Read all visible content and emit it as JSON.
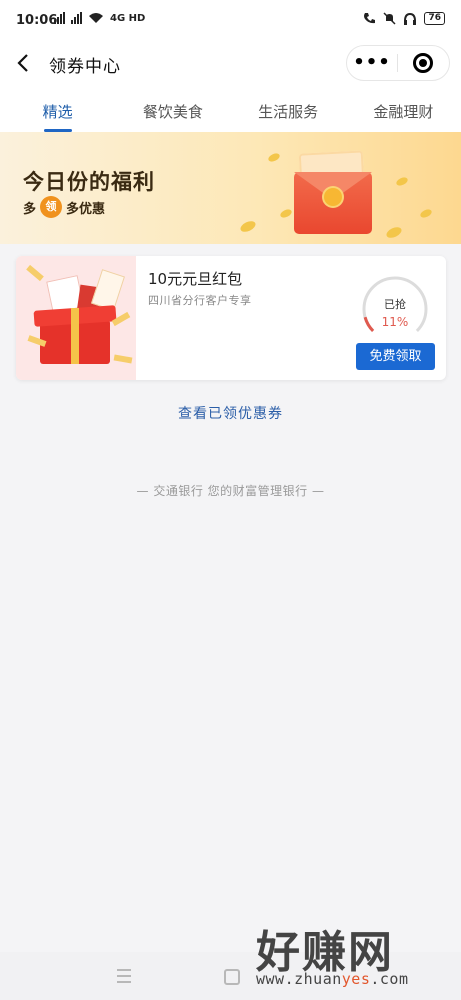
{
  "status_bar": {
    "time": "10:06",
    "network_label": "4G HD",
    "battery": "76"
  },
  "nav": {
    "title": "领券中心",
    "more_label": "•••"
  },
  "tabs": [
    {
      "label": "精选",
      "active": true
    },
    {
      "label": "餐饮美食",
      "active": false
    },
    {
      "label": "生活服务",
      "active": false
    },
    {
      "label": "金融理财",
      "active": false
    }
  ],
  "banner": {
    "title": "今日份的福利",
    "sub_prefix": "多",
    "sub_badge": "领",
    "sub_suffix": "多优惠"
  },
  "coupon": {
    "title": "10元元旦红包",
    "subtitle": "四川省分行客户专享",
    "progress_label": "已抢",
    "progress_percent": "11%",
    "progress_value": 0.11,
    "button_label": "免费领取"
  },
  "view_claimed_link": "查看已领优惠券",
  "slogan": "— 交通银行 您的财富管理银行 —",
  "watermark": {
    "big_text": "好赚网",
    "url_pre": "www.zhuan",
    "url_mid": "yes",
    "url_post": ".com"
  },
  "colors": {
    "accent": "#1b69d3",
    "tab_active": "#1f5eaa",
    "progress": "#e05a4f"
  },
  "icons": [
    "back-arrow-icon",
    "more-dots-icon",
    "close-target-icon",
    "menu-icon",
    "home-icon",
    "wifi-icon",
    "signal-icon",
    "battery-icon"
  ]
}
